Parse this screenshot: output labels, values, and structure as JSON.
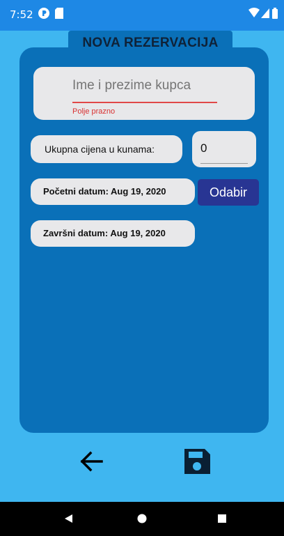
{
  "status_bar": {
    "time": "7:52"
  },
  "header": {
    "title": "NOVA REZERVACIJA"
  },
  "form": {
    "name_placeholder": "Ime i prezime kupca",
    "name_value": "",
    "name_error": "Polje prazno",
    "price_label": "Ukupna cijena u kunama:",
    "price_value": "0",
    "start_date_label": "Početni datum:",
    "start_date": "Aug 19, 2020",
    "end_date_label": "Završni datum:",
    "end_date": "Aug 19, 2020",
    "pick_button": "Odabir"
  },
  "actions": {
    "back_icon": "arrow-left-icon",
    "save_icon": "floppy-disk-icon"
  },
  "nav_bar": {
    "back": "triangle-back-icon",
    "home": "circle-home-icon",
    "recents": "square-recents-icon"
  },
  "colors": {
    "panel": "#0a70b8",
    "background": "#3fb6f0",
    "button": "#283593",
    "error": "#d83030"
  }
}
